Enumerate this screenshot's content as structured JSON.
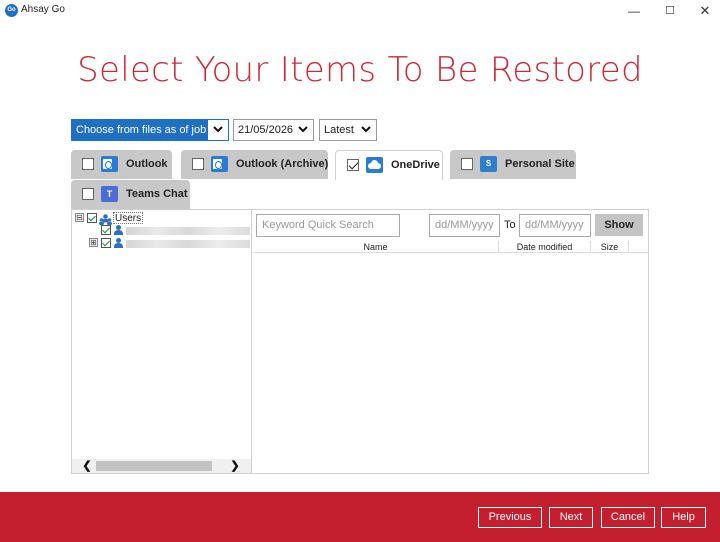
{
  "window": {
    "logo_text": "Go",
    "title": "Ahsay Go",
    "minimize_glyph": "—",
    "maximize_glyph": "☐",
    "close_glyph": "✕"
  },
  "heading": "Select Your Items To Be Restored",
  "selectors": {
    "job_mode": "Choose from files as of job",
    "date": "21/05/2026",
    "time": "Latest"
  },
  "tabs": [
    {
      "label": "Outlook",
      "checked": false,
      "icon": "outlook-icon"
    },
    {
      "label": "Outlook (Archive)",
      "checked": false,
      "icon": "outlook-icon"
    },
    {
      "label": "OneDrive",
      "checked": true,
      "icon": "onedrive-icon"
    },
    {
      "label": "Personal Site",
      "checked": false,
      "icon": "sharepoint-icon"
    },
    {
      "label": "Teams Chat",
      "checked": false,
      "icon": "teams-icon"
    }
  ],
  "tree": {
    "root_label": "Users",
    "root_expander": "⊟",
    "child_expander": "⊞",
    "children": [
      {
        "label": "",
        "blurred": true
      },
      {
        "label": "",
        "blurred": true
      }
    ],
    "scroll_left": "❮",
    "scroll_right": "❯"
  },
  "filter": {
    "search_placeholder": "Keyword Quick Search",
    "from_placeholder": "dd/MM/yyyy",
    "to_label": "To",
    "to_placeholder": "dd/MM/yyyy",
    "show_label": "Show"
  },
  "file_table": {
    "columns": [
      "Name",
      "Date modified",
      "Size"
    ],
    "rows": []
  },
  "footer": {
    "previous": "Previous",
    "next": "Next",
    "cancel": "Cancel",
    "help": "Help"
  },
  "colors": {
    "accent_red": "#c41f2e",
    "heading_red": "#c62d3a",
    "select_blue": "#1f6fc4"
  }
}
